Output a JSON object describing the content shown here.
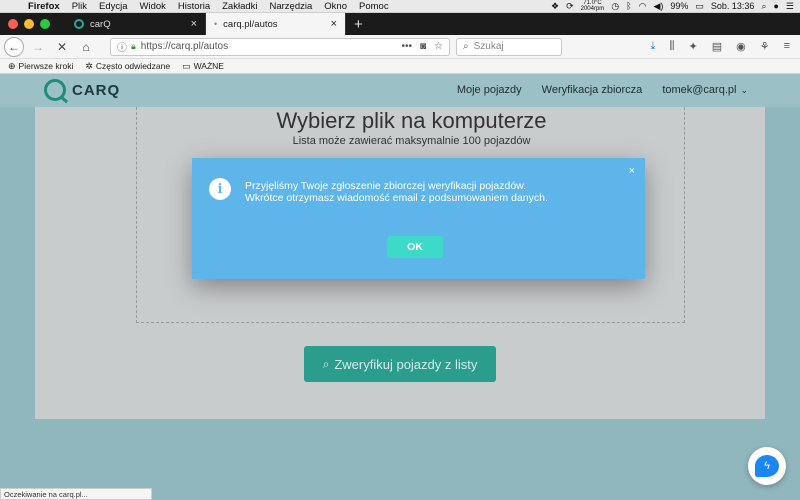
{
  "menubar": {
    "items": [
      "Firefox",
      "Plik",
      "Edycja",
      "Widok",
      "Historia",
      "Zakładki",
      "Narzędzia",
      "Okno",
      "Pomoc"
    ],
    "temp": "71.0°C",
    "rpm": "2004rpm",
    "battery": "99%",
    "clock": "Sob. 13:36"
  },
  "tabs": [
    {
      "label": "carQ",
      "active": false
    },
    {
      "label": "carq.pl/autos",
      "active": true
    }
  ],
  "navbar": {
    "url": "https://carq.pl/autos",
    "search_placeholder": "Szukaj"
  },
  "bookmarks": [
    "Pierwsze kroki",
    "Często odwiedzane",
    "WAŻNE"
  ],
  "site": {
    "brand": "CARQ",
    "nav": [
      "Moje pojazdy",
      "Weryfikacja zbiorcza"
    ],
    "user": "tomek@carq.pl"
  },
  "upload": {
    "title": "Wybierz plik na komputerze",
    "subtitle": "Lista może zawierać maksymalnie 100 pojazdów",
    "verify_button": "Zweryfikuj pojazdy z listy"
  },
  "modal": {
    "line1": "Przyjęliśmy Twoje zgłoszenie zbiorczej weryfikacji pojazdów.",
    "line2": "Wkrótce otrzymasz wiadomość email z podsumowaniem danych.",
    "ok_label": "OK",
    "close_glyph": "×"
  },
  "status": "Oczekiwanie na carq.pl...",
  "colors": {
    "modal_bg": "#5eb5ea",
    "ok_bg": "#3ddbc7",
    "brand": "#1f8c7c",
    "verify_bg": "#2a9d8d"
  }
}
